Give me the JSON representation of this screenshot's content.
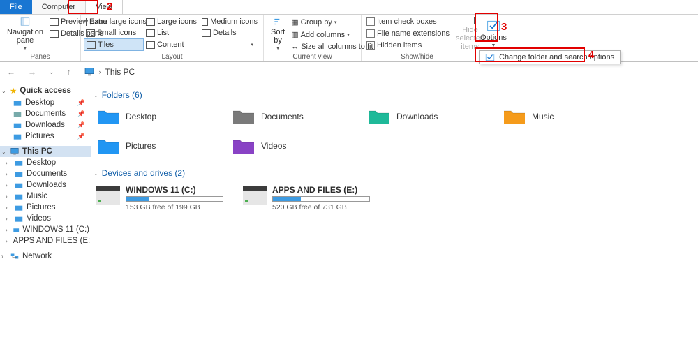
{
  "tabs": {
    "file": "File",
    "computer": "Computer",
    "view": "View"
  },
  "ribbon": {
    "panes": {
      "nav": "Navigation pane",
      "preview": "Preview pane",
      "details": "Details pane",
      "label": "Panes"
    },
    "layout": {
      "extra_large": "Extra large icons",
      "large": "Large icons",
      "medium": "Medium icons",
      "small": "Small icons",
      "list": "List",
      "details": "Details",
      "tiles": "Tiles",
      "content": "Content",
      "label": "Layout"
    },
    "current_view": {
      "sort": "Sort by",
      "group": "Group by",
      "add_cols": "Add columns",
      "size_cols": "Size all columns to fit",
      "label": "Current view"
    },
    "show_hide": {
      "checkboxes": "Item check boxes",
      "ext": "File name extensions",
      "hidden": "Hidden items",
      "hide_sel": "Hide selected items",
      "label": "Show/hide"
    },
    "options": {
      "btn": "Options",
      "change": "Change folder and search options"
    }
  },
  "breadcrumb": {
    "location": "This PC"
  },
  "quick_access": {
    "title": "Quick access",
    "items": [
      "Desktop",
      "Documents",
      "Downloads",
      "Pictures"
    ]
  },
  "this_pc": {
    "title": "This PC",
    "items": [
      "Desktop",
      "Documents",
      "Downloads",
      "Music",
      "Pictures",
      "Videos",
      "WINDOWS 11 (C:)",
      "APPS AND FILES (E:"
    ],
    "network": "Network"
  },
  "content": {
    "folders_header": "Folders (6)",
    "folders": [
      "Desktop",
      "Documents",
      "Downloads",
      "Music",
      "Pictures",
      "Videos"
    ],
    "drives_header": "Devices and drives (2)",
    "drives": [
      {
        "name": "WINDOWS 11 (C:)",
        "free_text": "153 GB free of 199 GB",
        "fill_pct": 23
      },
      {
        "name": "APPS AND FILES (E:)",
        "free_text": "520 GB free of 731 GB",
        "fill_pct": 29
      }
    ]
  },
  "annotations": {
    "n2": "2",
    "n3": "3",
    "n4": "4"
  },
  "folder_colors": [
    "#2296f3",
    "#7a7a7a",
    "#1fb999",
    "#f59b1b",
    "#2196f3",
    "#8942c5"
  ]
}
